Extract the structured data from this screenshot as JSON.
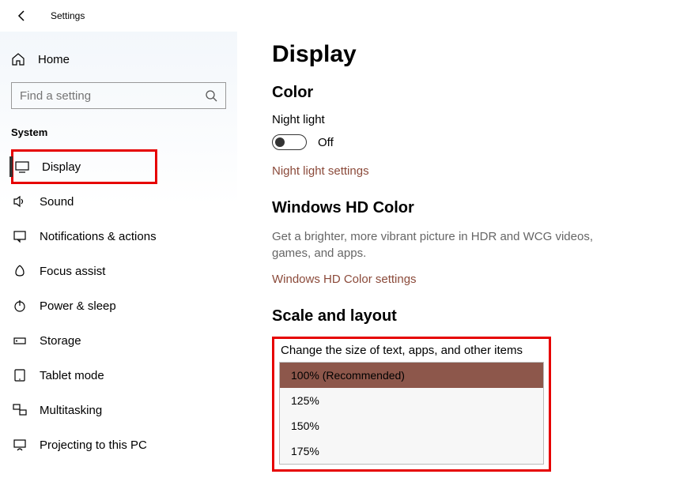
{
  "app": {
    "title": "Settings"
  },
  "sidebar": {
    "home": "Home",
    "search_placeholder": "Find a setting",
    "group": "System",
    "items": [
      {
        "label": "Display"
      },
      {
        "label": "Sound"
      },
      {
        "label": "Notifications & actions"
      },
      {
        "label": "Focus assist"
      },
      {
        "label": "Power & sleep"
      },
      {
        "label": "Storage"
      },
      {
        "label": "Tablet mode"
      },
      {
        "label": "Multitasking"
      },
      {
        "label": "Projecting to this PC"
      }
    ]
  },
  "main": {
    "title": "Display",
    "color": {
      "heading": "Color",
      "night_light_label": "Night light",
      "night_light_state": "Off",
      "night_light_link": "Night light settings"
    },
    "hd": {
      "heading": "Windows HD Color",
      "desc": "Get a brighter, more vibrant picture in HDR and WCG videos, games, and apps.",
      "link": "Windows HD Color settings"
    },
    "scale": {
      "heading": "Scale and layout",
      "label": "Change the size of text, apps, and other items",
      "options": [
        "100% (Recommended)",
        "125%",
        "150%",
        "175%"
      ],
      "selected": "100% (Recommended)"
    }
  }
}
